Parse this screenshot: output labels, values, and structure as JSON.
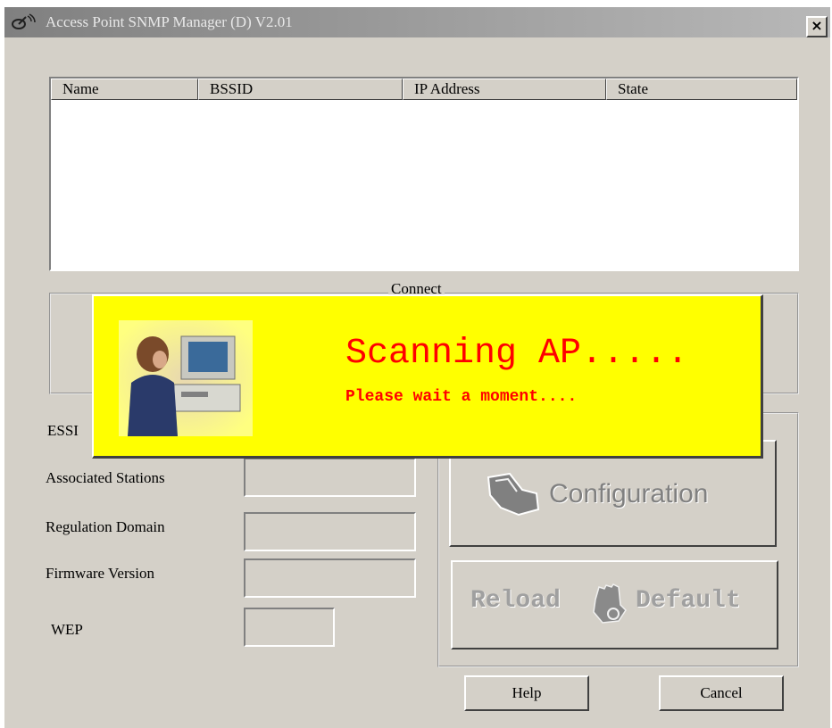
{
  "window": {
    "title": "Access Point SNMP Manager (D) V2.01",
    "close_symbol": "×"
  },
  "ap_list": {
    "columns": [
      "Name",
      "BSSID",
      "IP Address",
      "State"
    ],
    "rows": []
  },
  "connect_group": {
    "label": "Connect"
  },
  "fields": {
    "essid_label": "ESSI",
    "associated_label": "Associated Stations",
    "regulation_label": "Regulation Domain",
    "firmware_label": "Firmware Version",
    "wep_label": "WEP"
  },
  "buttons": {
    "configuration": "Configuration",
    "reload_default_left": "Reload",
    "reload_default_right": "Default",
    "help": "Help",
    "cancel": "Cancel"
  },
  "scan_dialog": {
    "title": "Scanning AP.....",
    "subtitle": "Please wait a moment...."
  },
  "icons": {
    "app": "satellite-dish-icon",
    "close": "close-icon",
    "configuration": "hand-config-icon",
    "reload_default": "reload-hand-icon",
    "scan_photo": "person-at-computer-image"
  },
  "colors": {
    "dialog_bg": "#d4d0c8",
    "overlay_bg": "#ffff00",
    "overlay_text": "#ff0000"
  }
}
